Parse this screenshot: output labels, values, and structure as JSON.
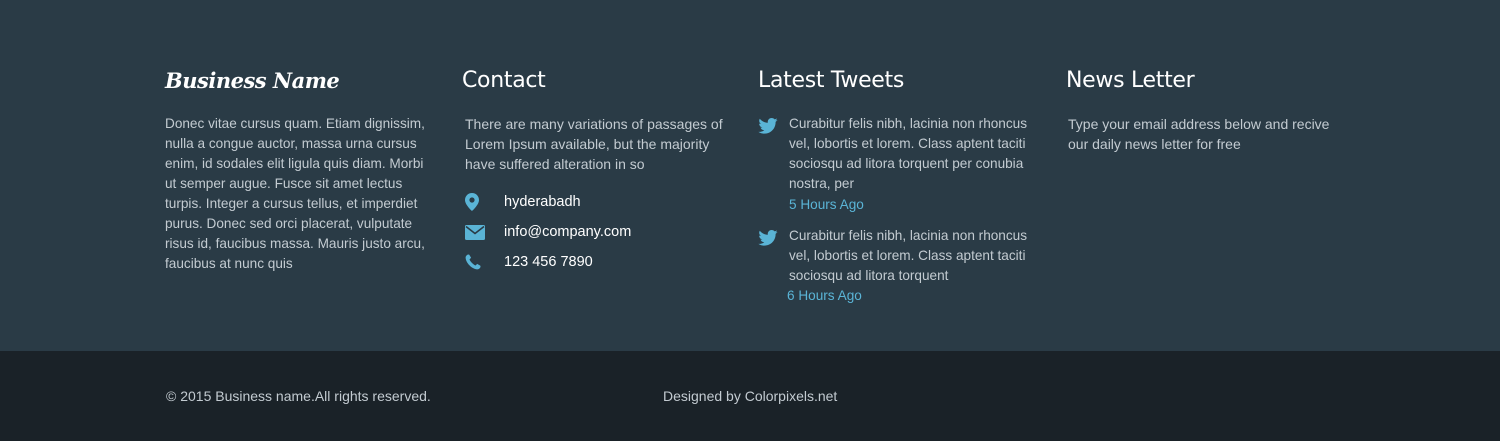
{
  "business": {
    "title": "Business Name",
    "description": "Donec vitae cursus quam. Etiam dignissim, nulla a congue auctor, massa urna cursus enim, id sodales elit ligula quis diam. Morbi ut semper augue. Fusce sit amet lectus turpis. Integer a cursus tellus, et imperdiet purus. Donec sed orci placerat, vulputate risus id, faucibus massa. Mauris justo arcu, faucibus at nunc quis"
  },
  "contact": {
    "title": "Contact",
    "description": "There are many variations of passages of Lorem Ipsum available, but the majority have suffered alteration in so",
    "items": [
      {
        "icon": "map-pin-icon",
        "text": "hyderabadh"
      },
      {
        "icon": "envelope-icon",
        "text": "info@company.com"
      },
      {
        "icon": "phone-icon",
        "text": "123 456 7890"
      }
    ]
  },
  "tweets": {
    "title": "Latest Tweets",
    "items": [
      {
        "icon": "twitter-icon",
        "text": "Curabitur felis nibh, lacinia non rhoncus vel, lobortis et lorem. Class aptent taciti sociosqu ad litora torquent per conubia nostra, per",
        "time": "5 Hours  Ago"
      },
      {
        "icon": "twitter-icon",
        "text": "Curabitur felis nibh, lacinia non rhoncus vel, lobortis et lorem. Class aptent taciti sociosqu ad litora torquent",
        "time": "6 Hours Ago"
      }
    ]
  },
  "newsletter": {
    "title": "News Letter",
    "description": "Type your email address below and recive our daily news letter for free"
  },
  "bottom": {
    "copyright": "© 2015 Business name.All rights reserved.",
    "designed_by": "Designed by Colorpixels.net"
  },
  "colors": {
    "top_background": "#2a3b46",
    "bottom_background": "#1a2228",
    "accent": "#5ab4d6",
    "body_text": "#c3cbd1",
    "heading": "#ffffff"
  }
}
